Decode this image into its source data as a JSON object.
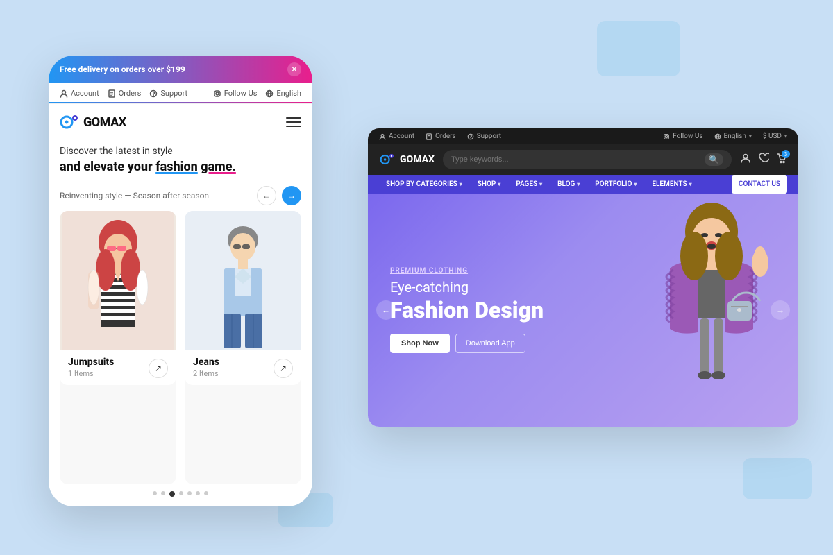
{
  "background": {
    "color": "#c8dff5"
  },
  "mobile": {
    "promo_banner": {
      "text": "Free delivery on orders over ",
      "amount": "$199",
      "close_label": "×"
    },
    "nav": {
      "items": [
        {
          "label": "Account",
          "icon": "user-icon"
        },
        {
          "label": "Orders",
          "icon": "orders-icon"
        },
        {
          "label": "Support",
          "icon": "support-icon"
        },
        {
          "label": "Follow Us",
          "icon": "instagram-icon"
        },
        {
          "label": "English",
          "icon": "globe-icon"
        }
      ]
    },
    "logo": {
      "text": "GOMAX",
      "icon": "go-icon"
    },
    "hero": {
      "subtitle": "Discover the latest in style",
      "title_line1": "and elevate your",
      "title_line2": "fashion game."
    },
    "slider": {
      "caption": "Reinventing style — Season after season"
    },
    "products": [
      {
        "name": "Jumpsuits",
        "count": "1 Items",
        "arrow": "↗"
      },
      {
        "name": "Jeans",
        "count": "2 Items",
        "arrow": "↗"
      }
    ],
    "dots": [
      "",
      "",
      "active",
      "",
      "",
      "",
      ""
    ]
  },
  "desktop": {
    "topbar": {
      "items": [
        "Account",
        "Orders",
        "Support"
      ],
      "right_items": [
        "Follow Us",
        "English",
        "$ USD"
      ]
    },
    "header": {
      "logo": "GOMAX",
      "search_placeholder": "Type keywords...",
      "search_btn": "🔍"
    },
    "nav": {
      "items": [
        {
          "label": "SHOP BY CATEGORIES",
          "has_dropdown": true
        },
        {
          "label": "SHOP",
          "has_dropdown": true
        },
        {
          "label": "PAGES",
          "has_dropdown": true
        },
        {
          "label": "BLOG",
          "has_dropdown": true
        },
        {
          "label": "PORTFOLIO",
          "has_dropdown": true
        },
        {
          "label": "ELEMENTS",
          "has_dropdown": true
        },
        {
          "label": "CONTACT US",
          "highlight": true
        }
      ]
    },
    "hero": {
      "label": "PREMIUM CLOTHING",
      "subtitle": "Eye-catching",
      "title": "Fashion Design",
      "btn_shop": "Shop Now",
      "btn_download": "Download App"
    }
  }
}
